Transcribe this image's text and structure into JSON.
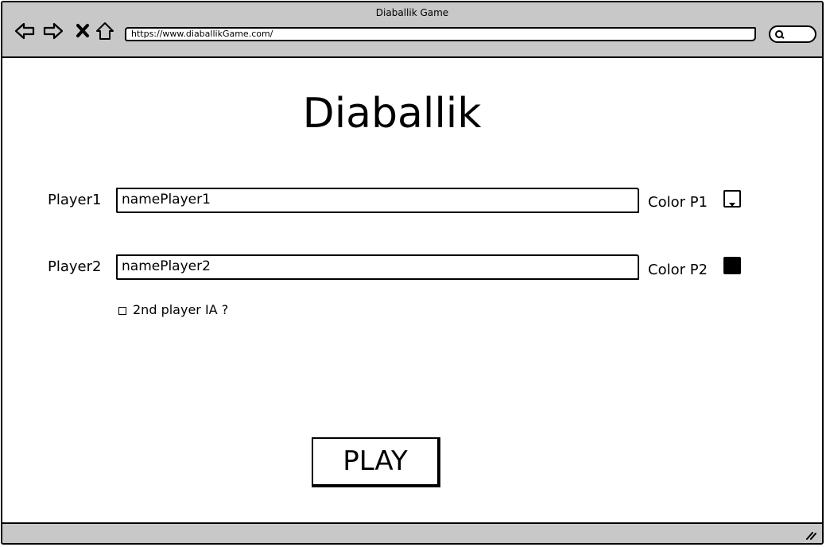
{
  "window": {
    "title": "Diaballik Game",
    "url": "https://www.diaballikGame.com/"
  },
  "icons": {
    "back": "arrow-left-icon",
    "forward": "arrow-right-icon",
    "stop": "close-icon",
    "home": "home-icon",
    "search": "search-icon",
    "resize": "resize-grip-icon"
  },
  "page": {
    "title": "Diaballik",
    "player1": {
      "label": "Player1",
      "value": "namePlayer1",
      "color_label": "Color P1",
      "color": "#ffffff"
    },
    "player2": {
      "label": "Player2",
      "value": "namePlayer2",
      "color_label": "Color P2",
      "color": "#000000"
    },
    "ai_option": {
      "label": "2nd player IA ?",
      "checked": false
    },
    "play_label": "PLAY"
  }
}
